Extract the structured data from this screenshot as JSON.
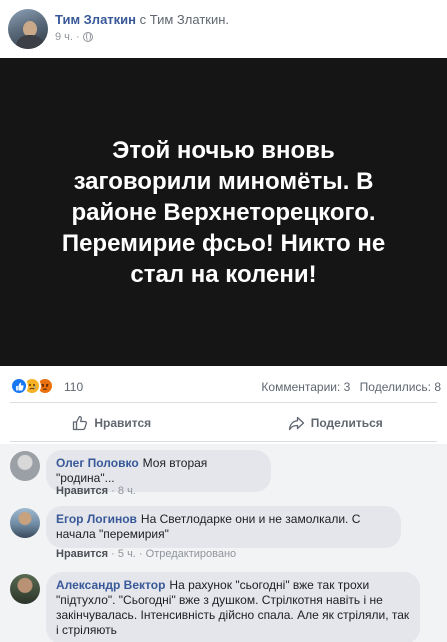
{
  "post": {
    "author": "Тим Златкин",
    "with_text": "с Тим Златкин.",
    "time": "9 ч.",
    "privacy_icon": "globe-icon",
    "image_text": "Этой ночью вновь заговорили миномёты. В районе Верхнеторецкого. Перемирие фсьо! Никто не стал на колени!"
  },
  "stats": {
    "reactions": [
      "like",
      "sad",
      "angry"
    ],
    "reaction_count": "110",
    "comments": "Комментарии: 3",
    "shares": "Поделились: 8"
  },
  "actions": {
    "like_label": "Нравится",
    "share_label": "Поделиться"
  },
  "comments": [
    {
      "name": "Олег Половко",
      "text": "Моя вторая \"родина\"...",
      "like": "Нравится",
      "sep": "·",
      "time": "8 ч.",
      "edited": ""
    },
    {
      "name": "Егор Логинов",
      "text": "На Светлодарке они и не замолкали. С начала \"перемирия\"",
      "like": "Нравится",
      "sep": "·",
      "time": "5 ч.",
      "edited": "· Отредактировано"
    },
    {
      "name": "Александр Вектор",
      "text": "На рахунок \"сьогодні\" вже так трохи \"підтухло\". \"Сьогодні\" вже з душком. Стрілкотня навіть і не закінчувалась. Інтенсивність дійсно спала. Але як стріляли, так і стріляють",
      "like": "",
      "sep": "",
      "time": "",
      "edited": ""
    }
  ],
  "colors": {
    "link": "#385898",
    "muted": "#606770",
    "comment_bg": "#f2f3f5",
    "bubble_bg": "#e4e6eb",
    "image_bg": "#151515"
  }
}
